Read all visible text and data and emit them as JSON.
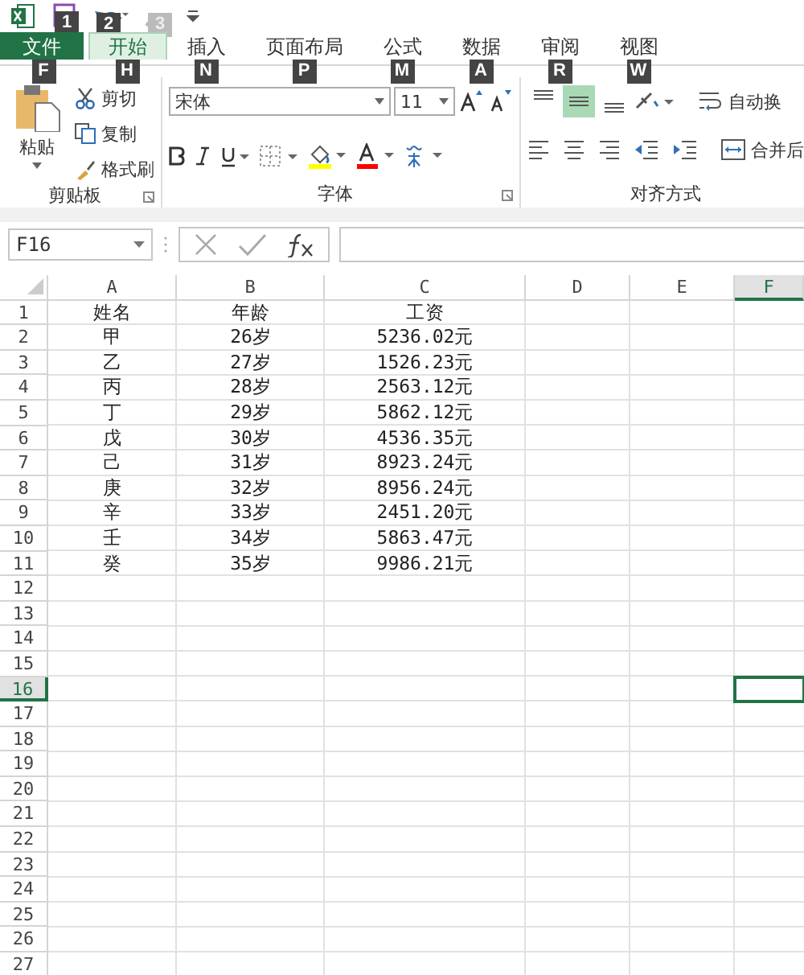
{
  "quick_access": [
    {
      "kind": "save",
      "keytip": "1",
      "disabled": false
    },
    {
      "kind": "undo",
      "keytip": "2",
      "disabled": false
    },
    {
      "kind": "redo",
      "keytip": "3",
      "disabled": true
    }
  ],
  "tabs": [
    {
      "label": "文件",
      "keytip": "F",
      "kind": "file",
      "selected": false
    },
    {
      "label": "开始",
      "keytip": "H",
      "kind": "tab",
      "selected": true
    },
    {
      "label": "插入",
      "keytip": "N",
      "kind": "tab",
      "selected": false
    },
    {
      "label": "页面布局",
      "keytip": "P",
      "kind": "tab",
      "selected": false
    },
    {
      "label": "公式",
      "keytip": "M",
      "kind": "tab",
      "selected": false
    },
    {
      "label": "数据",
      "keytip": "A",
      "kind": "tab",
      "selected": false
    },
    {
      "label": "审阅",
      "keytip": "R",
      "kind": "tab",
      "selected": false
    },
    {
      "label": "视图",
      "keytip": "W",
      "kind": "tab",
      "selected": false
    }
  ],
  "ribbon": {
    "clipboard": {
      "label": "剪贴板",
      "paste": "粘贴",
      "cut": "剪切",
      "copy": "复制",
      "format_painter": "格式刷"
    },
    "font": {
      "label": "字体",
      "font_name": "宋体",
      "font_size": "11"
    },
    "alignment": {
      "label": "对齐方式",
      "wrap_text": "自动换",
      "merge": "合并后",
      "vertical": [
        {
          "kind": "top",
          "selected": false
        },
        {
          "kind": "middle",
          "selected": true
        },
        {
          "kind": "bottom",
          "selected": false
        }
      ]
    }
  },
  "formula_bar": {
    "name_box": "F16"
  },
  "sheet": {
    "columns": [
      {
        "label": "A",
        "selected": false
      },
      {
        "label": "B",
        "selected": false
      },
      {
        "label": "C",
        "selected": false
      },
      {
        "label": "D",
        "selected": false
      },
      {
        "label": "E",
        "selected": false
      },
      {
        "label": "F",
        "selected": true
      }
    ],
    "rows": [
      {
        "label": "1",
        "selected": false,
        "cells": [
          "姓名",
          "年龄",
          "工资"
        ]
      },
      {
        "label": "2",
        "selected": false,
        "cells": [
          "甲",
          "26岁",
          "5236.02元"
        ]
      },
      {
        "label": "3",
        "selected": false,
        "cells": [
          "乙",
          "27岁",
          "1526.23元"
        ]
      },
      {
        "label": "4",
        "selected": false,
        "cells": [
          "丙",
          "28岁",
          "2563.12元"
        ]
      },
      {
        "label": "5",
        "selected": false,
        "cells": [
          "丁",
          "29岁",
          "5862.12元"
        ]
      },
      {
        "label": "6",
        "selected": false,
        "cells": [
          "戊",
          "30岁",
          "4536.35元"
        ]
      },
      {
        "label": "7",
        "selected": false,
        "cells": [
          "己",
          "31岁",
          "8923.24元"
        ]
      },
      {
        "label": "8",
        "selected": false,
        "cells": [
          "庚",
          "32岁",
          "8956.24元"
        ]
      },
      {
        "label": "9",
        "selected": false,
        "cells": [
          "辛",
          "33岁",
          "2451.20元"
        ]
      },
      {
        "label": "10",
        "selected": false,
        "cells": [
          "壬",
          "34岁",
          "5863.47元"
        ]
      },
      {
        "label": "11",
        "selected": false,
        "cells": [
          "癸",
          "35岁",
          "9986.21元"
        ]
      },
      {
        "label": "12",
        "selected": false
      },
      {
        "label": "13",
        "selected": false
      },
      {
        "label": "14",
        "selected": false
      },
      {
        "label": "15",
        "selected": false
      },
      {
        "label": "16",
        "selected": true
      },
      {
        "label": "17",
        "selected": false
      },
      {
        "label": "18",
        "selected": false
      },
      {
        "label": "19",
        "selected": false
      },
      {
        "label": "20",
        "selected": false
      },
      {
        "label": "21",
        "selected": false
      },
      {
        "label": "22",
        "selected": false
      },
      {
        "label": "23",
        "selected": false
      },
      {
        "label": "24",
        "selected": false
      },
      {
        "label": "25",
        "selected": false
      },
      {
        "label": "26",
        "selected": false
      },
      {
        "label": "27",
        "selected": false
      }
    ]
  }
}
